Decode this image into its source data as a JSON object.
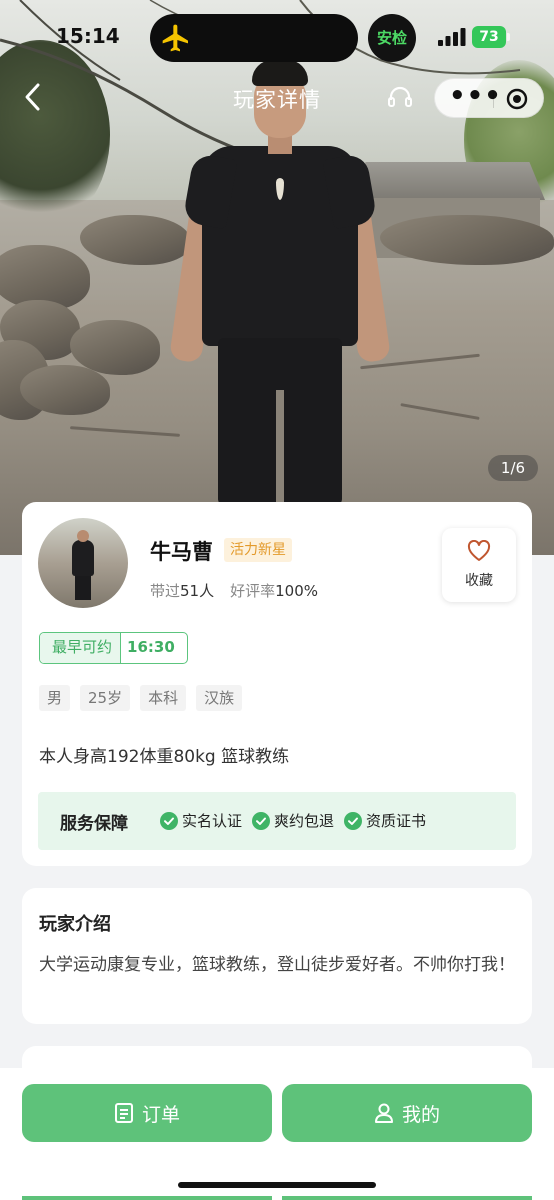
{
  "status_bar": {
    "time": "15:14",
    "safety_label": "安检",
    "battery": "73"
  },
  "nav": {
    "title": "玩家详情"
  },
  "photo": {
    "counter": "1/6"
  },
  "profile": {
    "name": "牛马曹",
    "level": "活力新星",
    "served_prefix": "带过",
    "served_count": "51人",
    "rating_prefix": "好评率",
    "rating_value": "100%",
    "favorite_label": "收藏",
    "earliest_label": "最早可约",
    "earliest_time": "16:30",
    "tags": [
      "男",
      "25岁",
      "本科",
      "汉族"
    ],
    "bio": "本人身高192体重80kg 篮球教练"
  },
  "guarantee": {
    "title": "服务保障",
    "items": [
      "实名认证",
      "爽约包退",
      "资质证书"
    ]
  },
  "intro": {
    "title": "玩家介绍",
    "text": "大学运动康复专业，篮球教练，登山徒步爱好者。不帅你打我！"
  },
  "bottom": {
    "orders_label": "订单",
    "mine_label": "我的"
  },
  "colors": {
    "accent_green": "#5ec27a",
    "badge_orange": "#e39a2b",
    "guarantee_bg": "#e7f6ec"
  }
}
